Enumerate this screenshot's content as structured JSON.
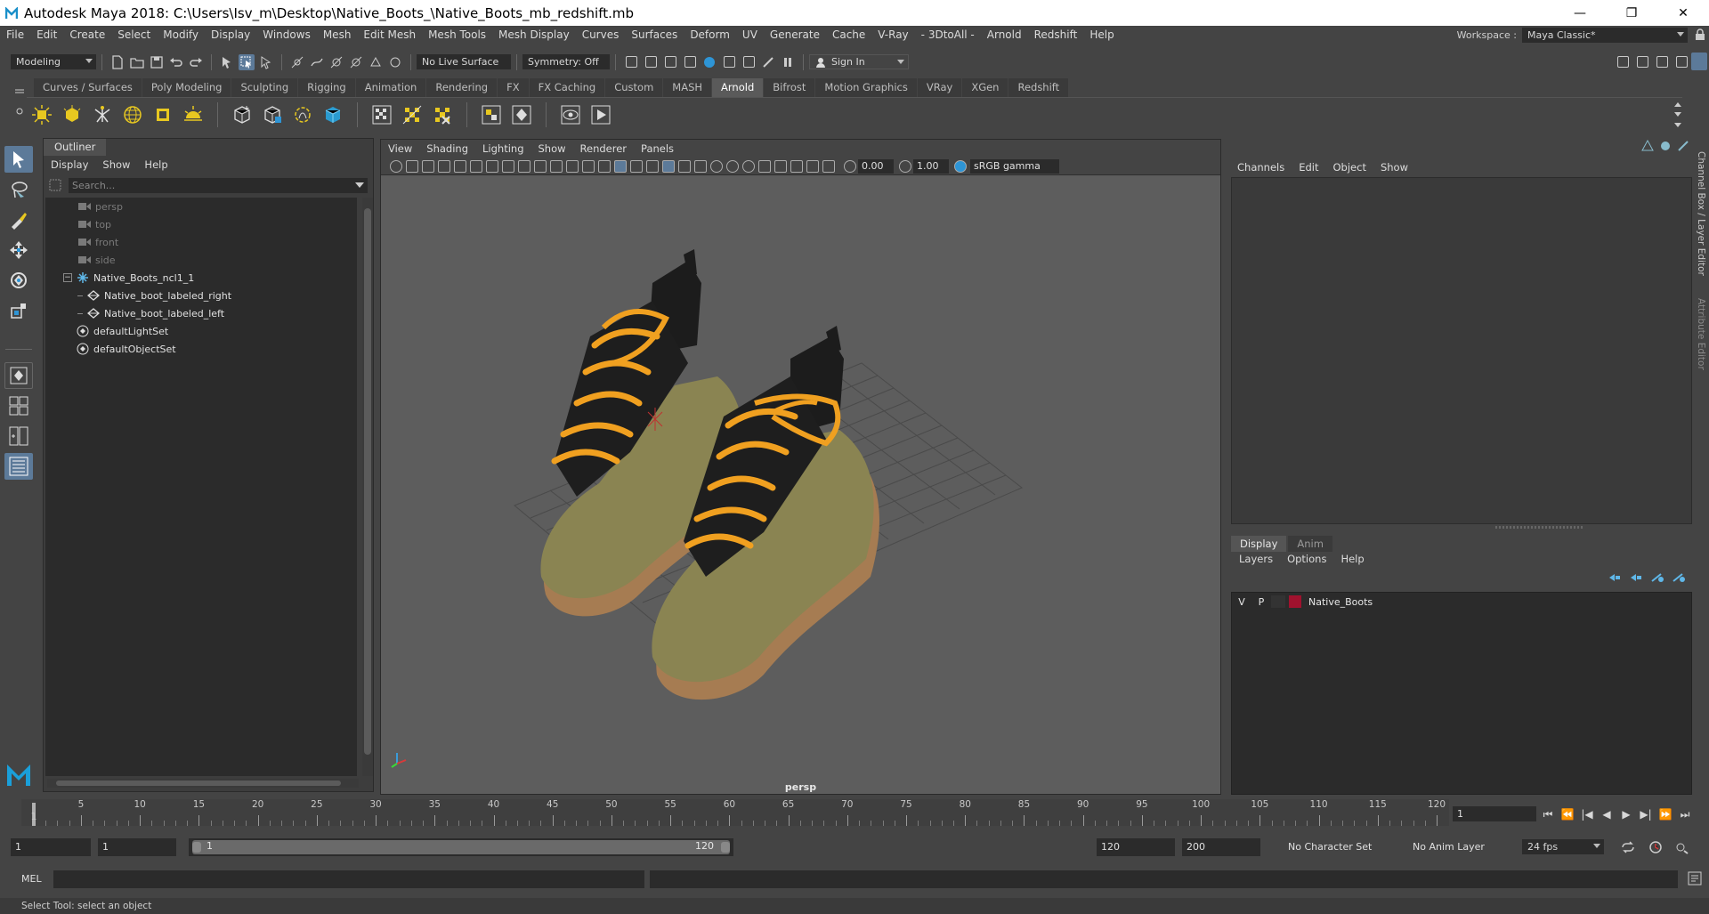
{
  "window": {
    "title": "Autodesk Maya 2018: C:\\Users\\Isv_m\\Desktop\\Native_Boots_\\Native_Boots_mb_redshift.mb"
  },
  "menubar": {
    "items": [
      "File",
      "Edit",
      "Create",
      "Select",
      "Modify",
      "Display",
      "Windows",
      "Mesh",
      "Edit Mesh",
      "Mesh Tools",
      "Mesh Display",
      "Curves",
      "Surfaces",
      "Deform",
      "UV",
      "Generate",
      "Cache",
      "V-Ray",
      "- 3DtoAll -",
      "Arnold",
      "Redshift",
      "Help"
    ],
    "workspace_label": "Workspace :",
    "workspace_value": "Maya Classic*"
  },
  "statusline": {
    "mode": "Modeling",
    "live_surface": "No Live Surface",
    "symmetry": "Symmetry: Off",
    "sign_in": "Sign In"
  },
  "shelf": {
    "tabs": [
      "Curves / Surfaces",
      "Poly Modeling",
      "Sculpting",
      "Rigging",
      "Animation",
      "Rendering",
      "FX",
      "FX Caching",
      "Custom",
      "MASH",
      "Arnold",
      "Bifrost",
      "Motion Graphics",
      "VRay",
      "XGen",
      "Redshift"
    ],
    "active_tab": "Arnold"
  },
  "outliner": {
    "title": "Outliner",
    "menu": [
      "Display",
      "Show",
      "Help"
    ],
    "search_placeholder": "Search...",
    "items": [
      {
        "label": "persp",
        "icon": "camera-icon",
        "dim": true,
        "indent": 2
      },
      {
        "label": "top",
        "icon": "camera-icon",
        "dim": true,
        "indent": 2
      },
      {
        "label": "front",
        "icon": "camera-icon",
        "dim": true,
        "indent": 2
      },
      {
        "label": "side",
        "icon": "camera-icon",
        "dim": true,
        "indent": 2
      },
      {
        "label": "Native_Boots_ncl1_1",
        "icon": "group-icon",
        "dim": false,
        "indent": 1
      },
      {
        "label": "Native_boot_labeled_right",
        "icon": "mesh-icon",
        "dim": false,
        "indent": 2
      },
      {
        "label": "Native_boot_labeled_left",
        "icon": "mesh-icon",
        "dim": false,
        "indent": 2
      },
      {
        "label": "defaultLightSet",
        "icon": "set-icon",
        "dim": false,
        "indent": 1
      },
      {
        "label": "defaultObjectSet",
        "icon": "set-icon",
        "dim": false,
        "indent": 1
      }
    ]
  },
  "viewport": {
    "menu": [
      "View",
      "Shading",
      "Lighting",
      "Show",
      "Renderer",
      "Panels"
    ],
    "exposure": "0.00",
    "gamma": "1.00",
    "color_space": "sRGB gamma",
    "camera": "persp"
  },
  "channelbox": {
    "menu": [
      "Channels",
      "Edit",
      "Object",
      "Show"
    ],
    "layer_tabs": [
      "Display",
      "Anim"
    ],
    "layer_menu": [
      "Layers",
      "Options",
      "Help"
    ],
    "layer": {
      "v": "V",
      "p": "P",
      "name": "Native_Boots",
      "color": "#a0122e"
    },
    "side_tabs": [
      "Channel Box / Layer Editor",
      "Attribute Editor"
    ]
  },
  "timeslider": {
    "labels": [
      5,
      10,
      15,
      20,
      25,
      30,
      35,
      40,
      45,
      50,
      55,
      60,
      65,
      70,
      75,
      80,
      85,
      90,
      95,
      100,
      105,
      110,
      115,
      120
    ],
    "current_frame_label": "1",
    "current_frame": "1"
  },
  "rangeslider": {
    "start": "1",
    "start_inner": "1",
    "range_start": "1",
    "range_end": "120",
    "end": "120",
    "end_outer": "200",
    "character_set": "No Character Set",
    "anim_layer": "No Anim Layer",
    "fps": "24 fps"
  },
  "cmdline": {
    "label": "MEL"
  },
  "helpline": {
    "text": "Select Tool: select an object"
  },
  "colors": {
    "accent": "#5c7a99",
    "lace": "#f0a020",
    "boot": "#8a8452",
    "sole": "#a67c52"
  }
}
